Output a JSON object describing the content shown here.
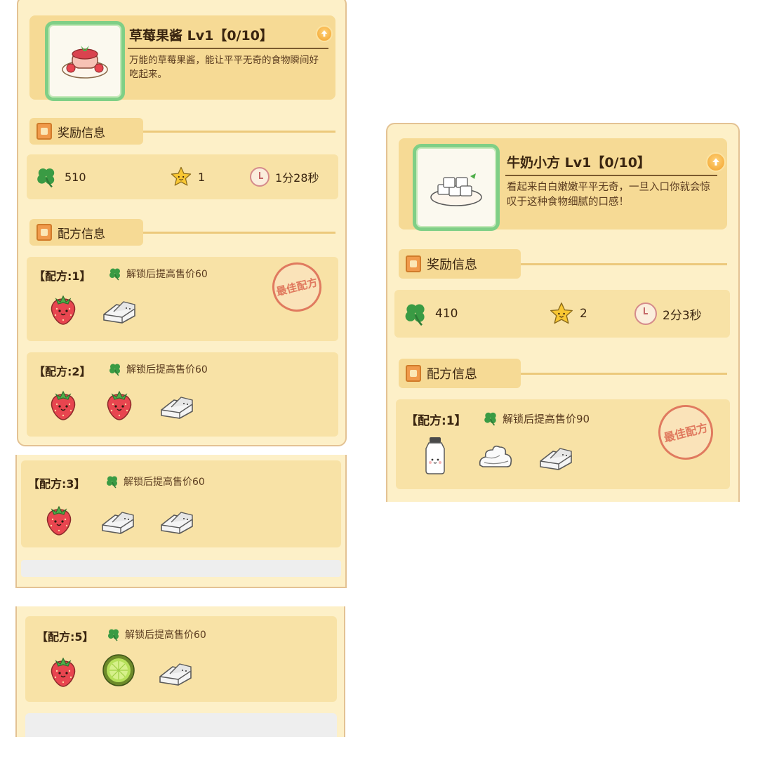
{
  "left_panel": {
    "item": {
      "title": "草莓果酱 Lv1【0/10】",
      "description": "万能的草莓果酱，能让平平无奇的食物瞬间好吃起来。",
      "icon": "strawberry-jam-plate"
    },
    "reward_heading": "奖励信息",
    "rewards": {
      "clover": "510",
      "star": "1",
      "time": "1分28秒"
    },
    "recipe_heading": "配方信息",
    "recipes": [
      {
        "title": "【配方:1】",
        "unlock": "解锁后提高售价60",
        "best": true,
        "ingredients": [
          "strawberry",
          "tofu"
        ]
      },
      {
        "title": "【配方:2】",
        "unlock": "解锁后提高售价60",
        "best": false,
        "ingredients": [
          "strawberry",
          "strawberry",
          "tofu"
        ]
      },
      {
        "title": "【配方:3】",
        "unlock": "解锁后提高售价60",
        "best": false,
        "ingredients": [
          "strawberry",
          "tofu",
          "tofu"
        ]
      },
      {
        "title": "【配方:5】",
        "unlock": "解锁后提高售价60",
        "best": false,
        "ingredients": [
          "strawberry",
          "lime",
          "tofu"
        ]
      }
    ],
    "stamp_text": "最佳配方"
  },
  "right_panel": {
    "item": {
      "title": "牛奶小方 Lv1【0/10】",
      "description": "看起来白白嫩嫩平平无奇，一旦入口你就会惊叹于这种食物细腻的口感！",
      "icon": "milk-cubes-plate"
    },
    "reward_heading": "奖励信息",
    "rewards": {
      "clover": "410",
      "star": "2",
      "time": "2分3秒"
    },
    "recipe_heading": "配方信息",
    "recipes": [
      {
        "title": "【配方:1】",
        "unlock": "解锁后提高售价90",
        "best": true,
        "ingredients": [
          "milk",
          "cream",
          "tofu"
        ]
      }
    ],
    "stamp_text": "最佳配方"
  },
  "colors": {
    "panel_bg": "#fdf0c8",
    "card_bg": "#f8e2a6",
    "header_bg": "#f6da95",
    "frame": "#e3c293",
    "thumb_border": "#7fcf86",
    "stamp": "#e07a5f"
  }
}
